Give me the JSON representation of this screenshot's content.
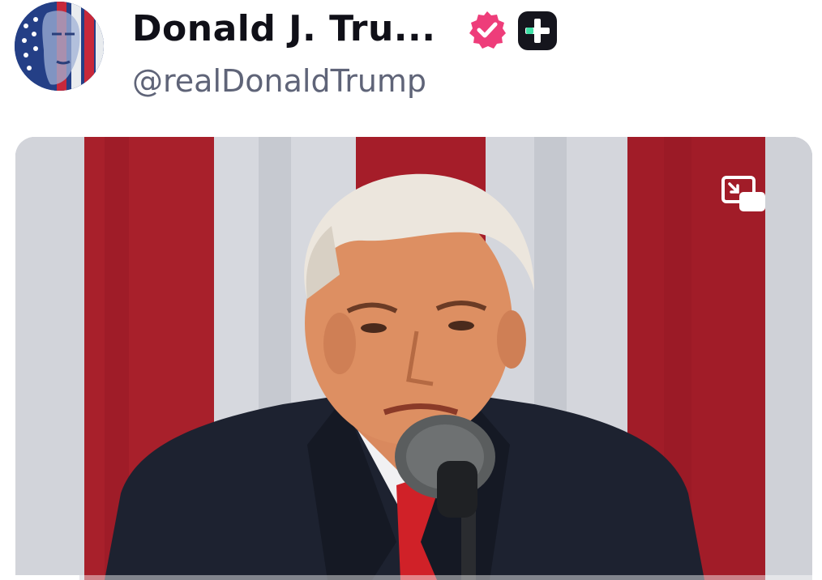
{
  "post": {
    "author": {
      "display_name": "Donald J. Tru...",
      "handle": "@realDonaldTrump",
      "avatar_icon": "flag-portrait-avatar",
      "verified_icon": "verified-badge-icon",
      "premium_icon": "plus-badge-icon"
    },
    "media": {
      "type": "video",
      "pip_icon": "picture-in-picture-icon",
      "progress": 0.08
    }
  },
  "colors": {
    "name_text": "#101018",
    "handle_text": "#5f6478",
    "verified_badge": "#ee3d7a",
    "premium_badge": "#15151d",
    "premium_accent": "#3fe0a6"
  }
}
